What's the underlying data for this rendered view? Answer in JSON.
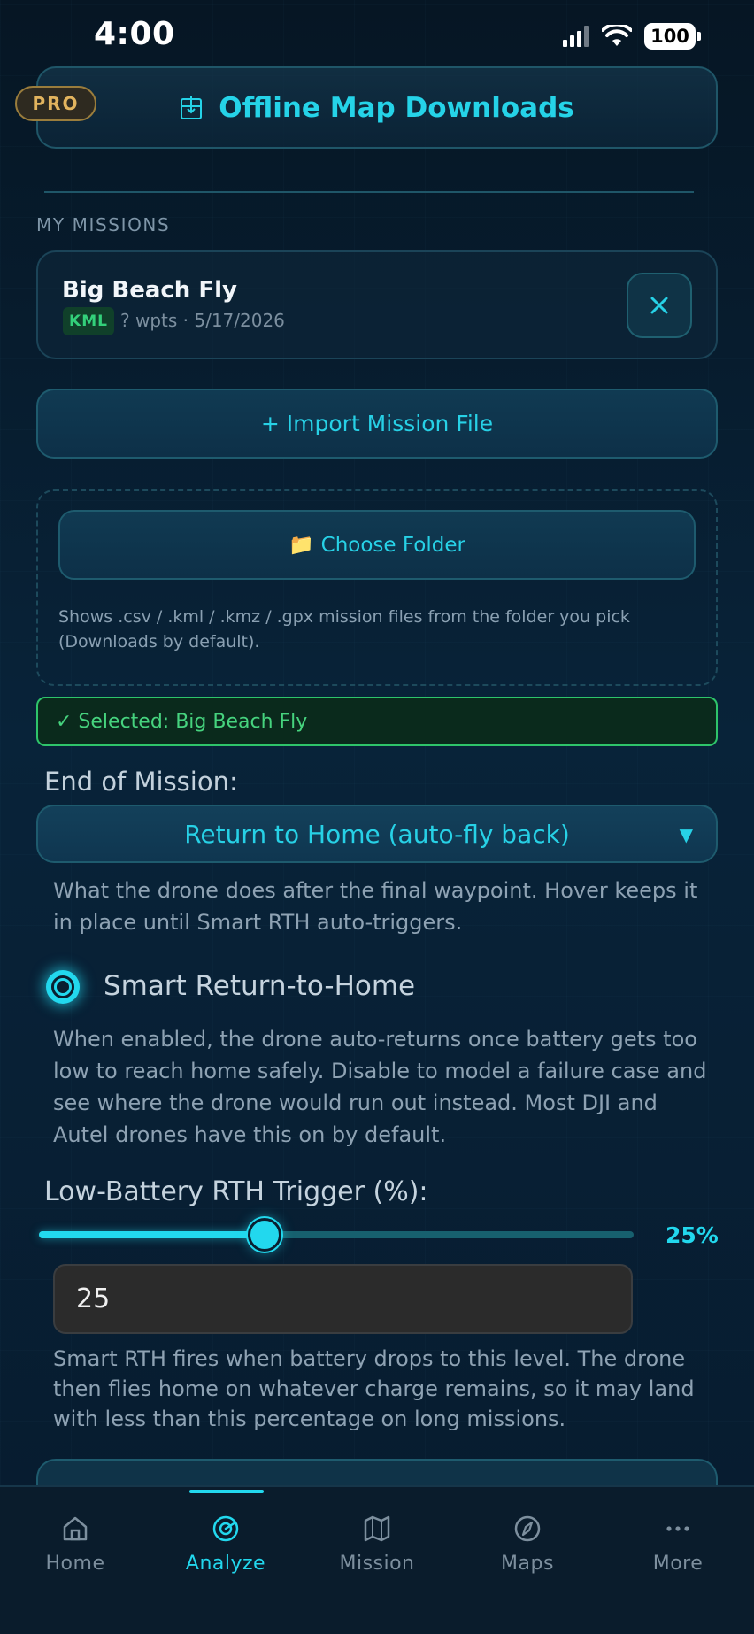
{
  "status_bar": {
    "time": "4:00",
    "battery": "100"
  },
  "header": {
    "pro_badge": "PRO",
    "offline_title": "Offline Map Downloads"
  },
  "missions": {
    "section_label": "MY MISSIONS",
    "items": [
      {
        "name": "Big Beach Fly",
        "type": "KML",
        "meta": "? wpts · 5/17/2026"
      }
    ],
    "remove_symbol": "✕"
  },
  "import_button": "+ Import Mission File",
  "folder": {
    "icon": "📁",
    "button_label": "Choose Folder",
    "help": "Shows .csv / .kml / .kmz / .gpx mission files from the folder you pick (Downloads by default)."
  },
  "selected": "✓ Selected: Big Beach Fly",
  "end_of_mission": {
    "label": "End of Mission:",
    "value": "Return to Home (auto-fly back)",
    "caret": "▼",
    "help": "What the drone does after the final waypoint. Hover keeps it in place until Smart RTH auto-triggers."
  },
  "smart_rth": {
    "label": "Smart Return-to-Home",
    "enabled": true,
    "help": "When enabled, the drone auto-returns once battery gets too low to reach home safely. Disable to model a failure case and see where the drone would run out instead. Most DJI and Autel drones have this on by default."
  },
  "low_battery": {
    "label": "Low-Battery RTH Trigger (%):",
    "value": 25,
    "value_display": "25%",
    "input_value": "25",
    "slider_fraction": 0.38,
    "help": "Smart RTH fires when battery drops to this level. The drone then flies home on whatever charge remains, so it may land with less than this percentage on long missions."
  },
  "nav": {
    "active": "Analyze",
    "items": [
      {
        "label": "Home",
        "icon": "home-icon"
      },
      {
        "label": "Analyze",
        "icon": "radar-icon"
      },
      {
        "label": "Mission",
        "icon": "map-icon"
      },
      {
        "label": "Maps",
        "icon": "compass-icon"
      },
      {
        "label": "More",
        "icon": "more-dots-icon"
      }
    ]
  },
  "colors": {
    "accent": "#22d8ee",
    "success": "#2ec46a",
    "pro": "#e2b45e",
    "background": "#071a2c"
  }
}
